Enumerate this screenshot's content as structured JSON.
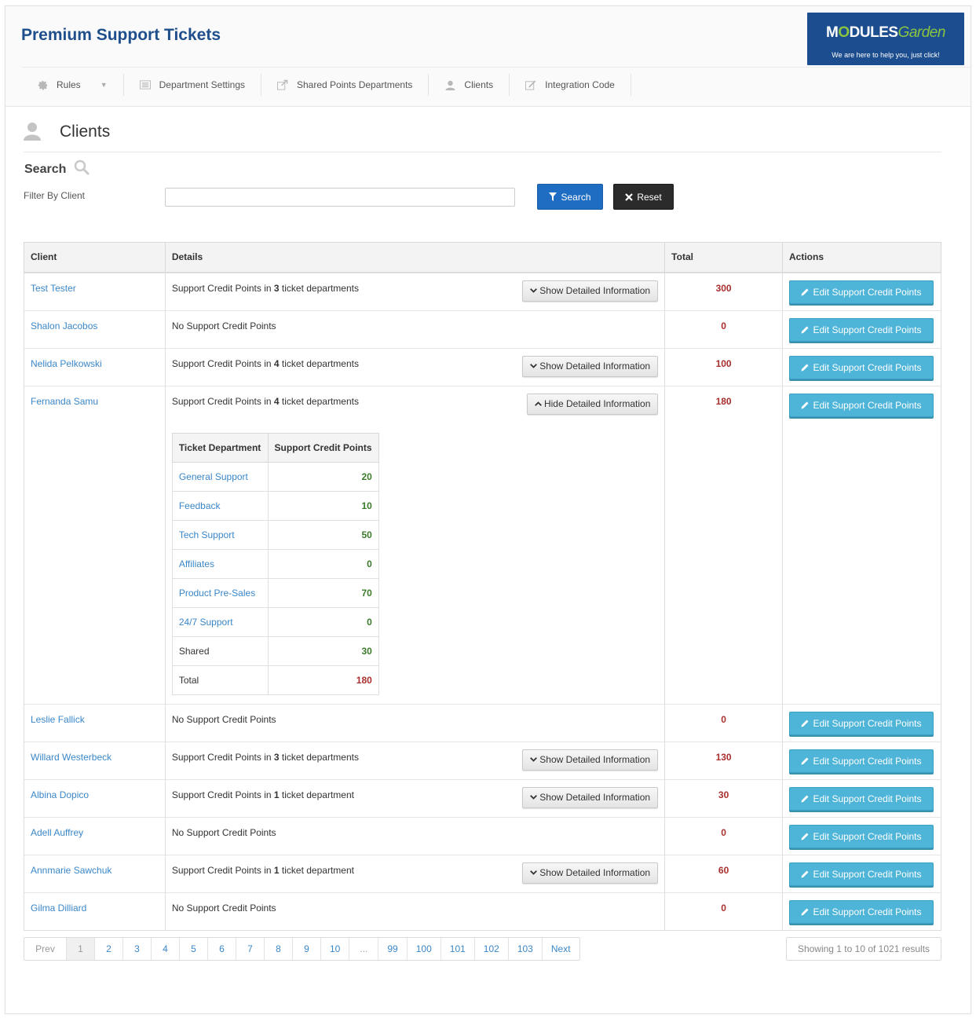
{
  "app_title": "Premium Support Tickets",
  "logo": {
    "brand_prefix": "M",
    "brand_o": "O",
    "brand_mid": "DULES",
    "brand_suffix": "Garden",
    "tagline": "We are here to help you, just click!"
  },
  "nav": [
    {
      "label": "Rules",
      "icon": "gear-icon"
    },
    {
      "label": "Department Settings",
      "icon": "list-icon"
    },
    {
      "label": "Shared Points Departments",
      "icon": "share-icon"
    },
    {
      "label": "Clients",
      "icon": "user-icon"
    },
    {
      "label": "Integration Code",
      "icon": "edit-icon"
    }
  ],
  "page": {
    "title": "Clients",
    "search_heading": "Search",
    "filter_label": "Filter By Client",
    "filter_value": "",
    "search_button": "Search",
    "reset_button": "Reset"
  },
  "table": {
    "headers": {
      "client": "Client",
      "details": "Details",
      "total": "Total",
      "actions": "Actions"
    },
    "edit_label": "Edit Support Credit Points",
    "show_label": "Show Detailed Information",
    "hide_label": "Hide Detailed Information",
    "rows": [
      {
        "client": "Test Tester",
        "pre": "Support Credit Points in ",
        "count": "3",
        "post": " ticket departments",
        "total": "300",
        "button": "show"
      },
      {
        "client": "Shalon Jacobos",
        "pre": "No Support Credit Points",
        "count": "",
        "post": "",
        "total": "0",
        "button": ""
      },
      {
        "client": "Nelida Pelkowski",
        "pre": "Support Credit Points in ",
        "count": "4",
        "post": " ticket departments",
        "total": "100",
        "button": "show"
      },
      {
        "client": "Fernanda Samu",
        "pre": "Support Credit Points in ",
        "count": "4",
        "post": " ticket departments",
        "total": "180",
        "button": "hide",
        "expanded": true
      },
      {
        "client": "Leslie Fallick",
        "pre": "No Support Credit Points",
        "count": "",
        "post": "",
        "total": "0",
        "button": ""
      },
      {
        "client": "Willard Westerbeck",
        "pre": "Support Credit Points in ",
        "count": "3",
        "post": " ticket departments",
        "total": "130",
        "button": "show"
      },
      {
        "client": "Albina Dopico",
        "pre": "Support Credit Points in ",
        "count": "1",
        "post": " ticket department",
        "total": "30",
        "button": "show"
      },
      {
        "client": "Adell Auffrey",
        "pre": "No Support Credit Points",
        "count": "",
        "post": "",
        "total": "0",
        "button": ""
      },
      {
        "client": "Annmarie Sawchuk",
        "pre": "Support Credit Points in ",
        "count": "1",
        "post": " ticket department",
        "total": "60",
        "button": "show"
      },
      {
        "client": "Gilma Dilliard",
        "pre": "No Support Credit Points",
        "count": "",
        "post": "",
        "total": "0",
        "button": ""
      }
    ],
    "detail": {
      "headers": {
        "department": "Ticket Department",
        "points": "Support Credit Points"
      },
      "rows": [
        {
          "department": "General Support",
          "points": "20",
          "link": true
        },
        {
          "department": "Feedback",
          "points": "10",
          "link": true
        },
        {
          "department": "Tech Support",
          "points": "50",
          "link": true
        },
        {
          "department": "Affiliates",
          "points": "0",
          "link": true
        },
        {
          "department": "Product Pre-Sales",
          "points": "70",
          "link": true
        },
        {
          "department": "24/7 Support",
          "points": "0",
          "link": true
        },
        {
          "department": "Shared",
          "points": "30",
          "link": false
        },
        {
          "department": "Total",
          "points": "180",
          "link": false,
          "total": true
        }
      ]
    }
  },
  "pagination": {
    "items": [
      "Prev",
      "1",
      "2",
      "3",
      "4",
      "5",
      "6",
      "7",
      "8",
      "9",
      "10",
      "...",
      "99",
      "100",
      "101",
      "102",
      "103",
      "Next"
    ],
    "active": "1",
    "disabled": [
      "Prev"
    ],
    "showing": "Showing 1 to 10 of 1021 results"
  },
  "colors": {
    "title_blue": "#1f4e8c",
    "link_blue": "#3a87c8",
    "total_red": "#a92e2e",
    "points_green": "#3a7a2a",
    "edit_button": "#4eb4d8",
    "search_button": "#1f6dc2",
    "reset_button": "#2b2b2b",
    "logo_bg": "#1c4d8f",
    "logo_accent": "#8bc53f"
  }
}
